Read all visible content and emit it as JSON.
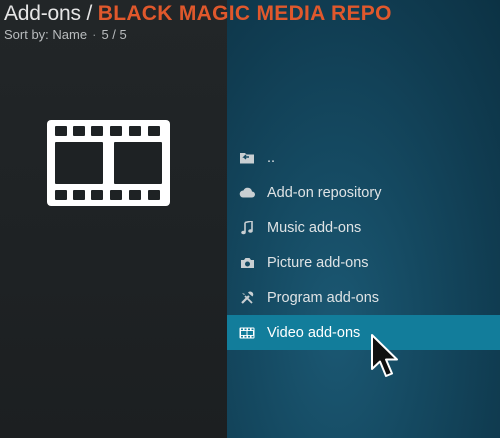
{
  "header": {
    "prefix": "Add-ons / ",
    "repo_name": "BLACK MAGIC MEDIA REPO",
    "sort_label": "Sort by: Name",
    "separator": "·",
    "count": "5 / 5"
  },
  "list": {
    "items": [
      {
        "label": "..",
        "icon": "folder-back-icon"
      },
      {
        "label": "Add-on repository",
        "icon": "cloud-icon"
      },
      {
        "label": "Music add-ons",
        "icon": "music-note-icon"
      },
      {
        "label": "Picture add-ons",
        "icon": "camera-icon"
      },
      {
        "label": "Program add-ons",
        "icon": "tools-icon"
      },
      {
        "label": "Video add-ons",
        "icon": "film-icon"
      }
    ],
    "selected": "Video add-ons"
  },
  "colors": {
    "accent": "#e0582c",
    "selection": "#127d9b",
    "panel_left": "#1e2224",
    "panel_right": "#154a62"
  }
}
